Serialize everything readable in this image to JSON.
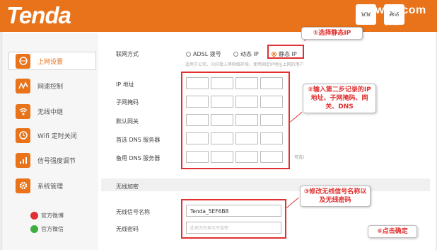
{
  "header": {
    "brand": "Tenda",
    "box1_label": "查查",
    "box2_label": "腾达",
    "watermark": "www.t3.com",
    "small_text": "官方微信"
  },
  "sidebar": {
    "items": [
      {
        "label": "上网设置",
        "icon": "globe-icon"
      },
      {
        "label": "网速控制",
        "icon": "speed-icon"
      },
      {
        "label": "无线中继",
        "icon": "wifi-relay-icon"
      },
      {
        "label": "Wifi 定时关闭",
        "icon": "clock-icon"
      },
      {
        "label": "信号强度调节",
        "icon": "signal-icon"
      },
      {
        "label": "系统管理",
        "icon": "gear-icon"
      }
    ],
    "weibo": "官方微博",
    "weixin": "官方微信"
  },
  "form": {
    "connection_label": "联网方式",
    "modes": [
      "ADSL 拨号",
      "动态 IP",
      "静态 IP"
    ],
    "selected_mode": "静态 IP",
    "hint": "适用于公司、光纤接入等网络环境，使用固定IP地址上网的用户",
    "ip_label": "IP 地址",
    "mask_label": "子网掩码",
    "gateway_label": "默认网关",
    "dns1_label": "首选 DNS 服务器",
    "dns2_label": "备用 DNS 服务器",
    "optional": "可选）"
  },
  "wireless": {
    "section_title": "无线加密",
    "ssid_label": "无线信号名称",
    "ssid_value": "Tenda_5EF6B8",
    "pwd_label": "无线密码",
    "pwd_placeholder": "此项为空表示不加密"
  },
  "callouts": {
    "c1": "①选择静态IP",
    "c2": "②输入第二步记录的IP地址、子网掩码、网关、DNS",
    "c3": "③修改无线信号名称以及无线密码",
    "c4": "④点击确定"
  },
  "colors": {
    "accent": "#e8731a",
    "annotation": "#e03030"
  }
}
